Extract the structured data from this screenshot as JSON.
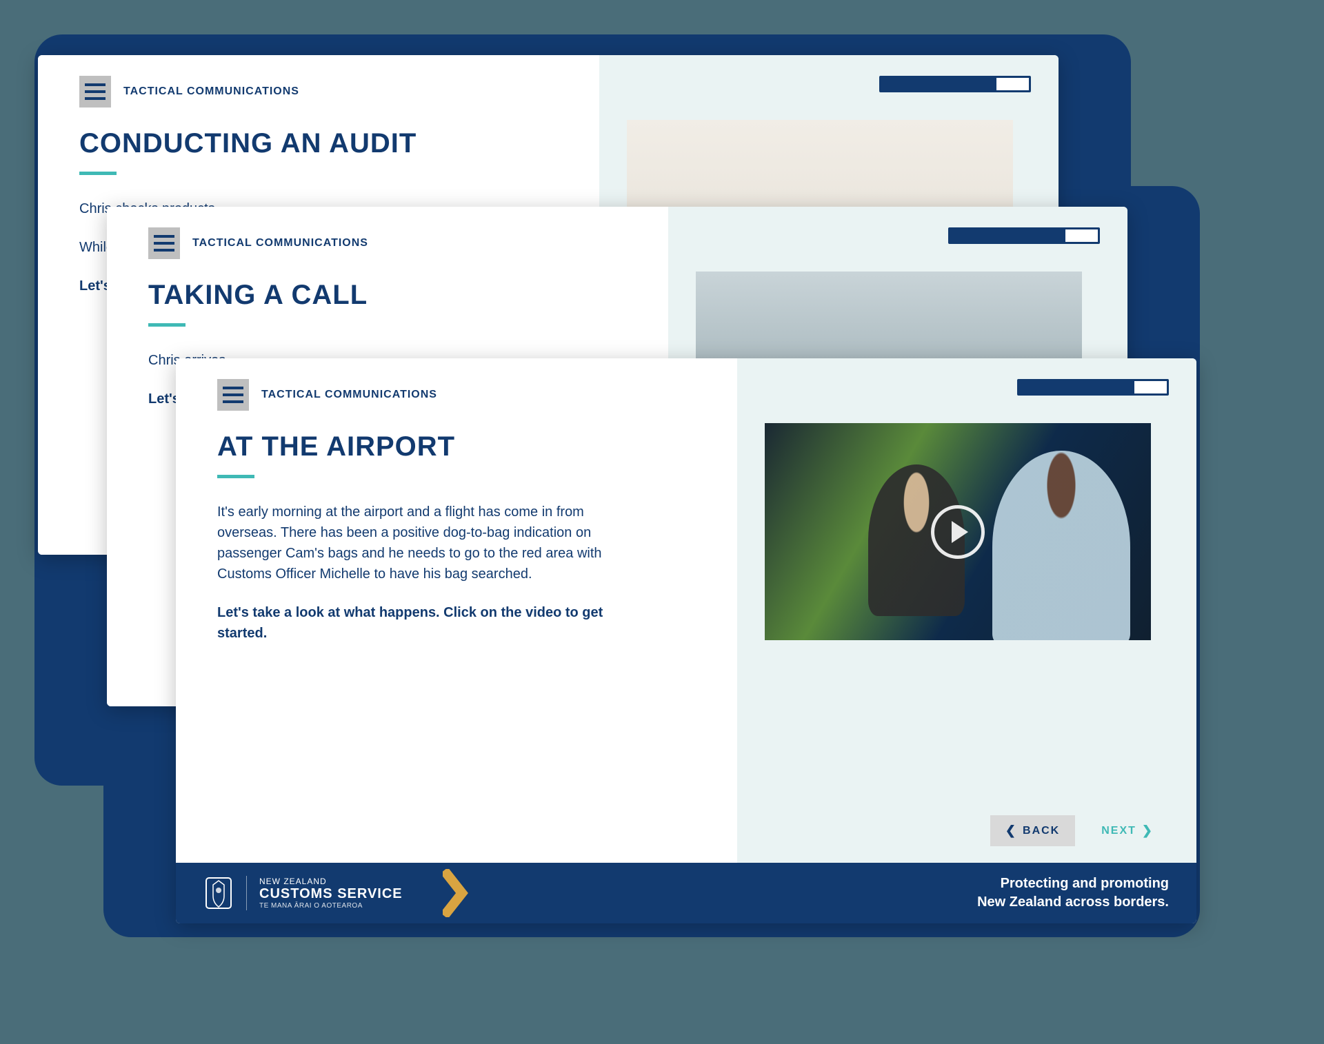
{
  "module_label": "TACTICAL COMMUNICATIONS",
  "progress_percent": 78,
  "cards": {
    "audit": {
      "title": "CONDUCTING AN AUDIT",
      "para1": "Chris checks products...",
      "para2": "While whisky they...",
      "cta": "Let's get ..."
    },
    "call": {
      "title": "TAKING A CALL",
      "para1": "Chris arrives...",
      "cta": "Let's get ..."
    },
    "airport": {
      "title": "AT THE AIRPORT",
      "para1": "It's early morning at the airport and a flight has come in from overseas. There has been a positive dog-to-bag indication on passenger Cam's bags and he needs to go to the red area with Customs Officer Michelle to have his bag searched.",
      "cta": "Let's take a look at what happens. Click on the video to get started."
    }
  },
  "nav": {
    "back": "BACK",
    "next": "NEXT"
  },
  "footer": {
    "logo_l1": "NEW ZEALAND",
    "logo_l2": "CUSTOMS SERVICE",
    "logo_l3": "TE MANA ĀRAI O AOTEAROA",
    "tagline_l1": "Protecting and promoting",
    "tagline_l2": "New Zealand across borders."
  }
}
